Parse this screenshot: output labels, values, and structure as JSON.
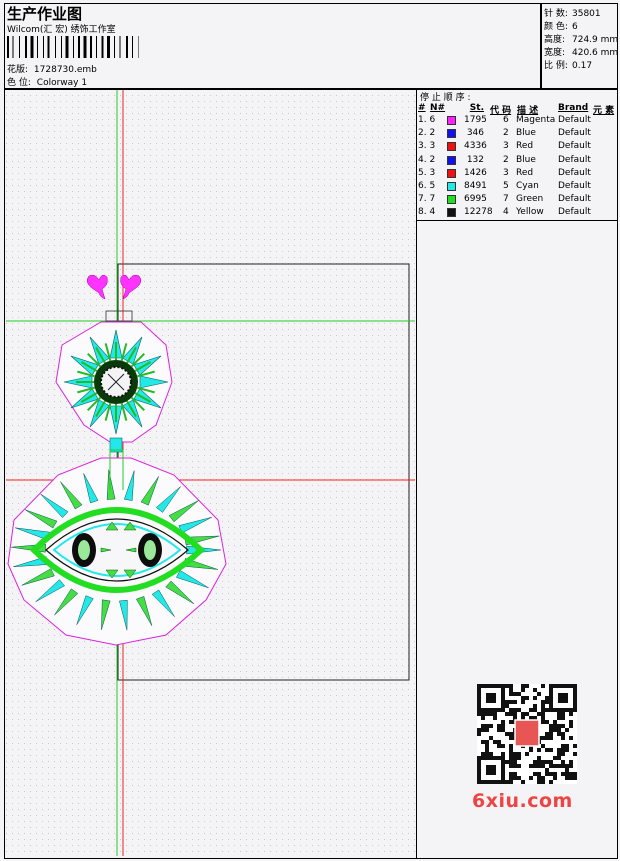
{
  "header": {
    "title": "生产作业图",
    "studio": "Wilcom(汇 宏) 绣饰工作室",
    "pattern_label": "花版:",
    "pattern_value": "1728730.emb",
    "colorway_label": "色 位:",
    "colorway_value": "Colorway 1"
  },
  "stats": [
    {
      "label": "针 数:",
      "value": "35801"
    },
    {
      "label": "颜 色:",
      "value": "6"
    },
    {
      "label": "高度:",
      "value": "724.9 mm"
    },
    {
      "label": "宽度:",
      "value": "420.6 mm"
    },
    {
      "label": "比 例:",
      "value": "0.17"
    }
  ],
  "stop_sequence": {
    "title": "停 止 顺 序 :",
    "headers": {
      "num": "#",
      "n": "N#",
      "st": "St.",
      "code": "代 码",
      "desc": "描 述",
      "brand": "Brand",
      "element": "元 素"
    },
    "rows": [
      {
        "num": "1. 6",
        "color": "#ff22ff",
        "st": "1795",
        "code": "6",
        "desc": "Magenta",
        "brand": "Default"
      },
      {
        "num": "2. 2",
        "color": "#1010f0",
        "st": "346",
        "code": "2",
        "desc": "Blue",
        "brand": "Default"
      },
      {
        "num": "3. 3",
        "color": "#ee1111",
        "st": "4336",
        "code": "3",
        "desc": "Red",
        "brand": "Default"
      },
      {
        "num": "4. 2",
        "color": "#1010f0",
        "st": "132",
        "code": "2",
        "desc": "Blue",
        "brand": "Default"
      },
      {
        "num": "5. 3",
        "color": "#ee1111",
        "st": "1426",
        "code": "3",
        "desc": "Red",
        "brand": "Default"
      },
      {
        "num": "6. 5",
        "color": "#22e8e8",
        "st": "8491",
        "code": "5",
        "desc": "Cyan",
        "brand": "Default"
      },
      {
        "num": "7. 7",
        "color": "#22dd22",
        "st": "6995",
        "code": "7",
        "desc": "Green",
        "brand": "Default"
      },
      {
        "num": "8. 4",
        "color": "#111111",
        "st": "12278",
        "code": "4",
        "desc": "Yellow",
        "brand": "Default"
      }
    ]
  },
  "watermark": {
    "text": "6xiu.com",
    "color": "#e84444"
  },
  "colors": {
    "guide_red": "#ee2222",
    "guide_green": "#22cc22",
    "outline_magenta": "#dd22dd"
  }
}
